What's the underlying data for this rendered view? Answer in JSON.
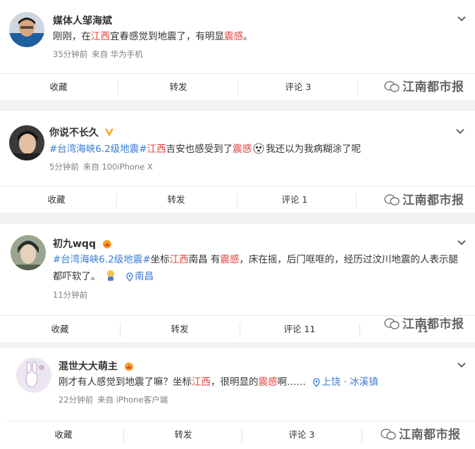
{
  "posts": [
    {
      "username": "媒体人邹海斌",
      "text_parts": [
        "刚刚，在",
        "江西",
        "宜春感觉到地震了，有明显",
        "震感",
        "。"
      ],
      "time": "35分钟前",
      "source": "来自 华为手机",
      "actions": [
        "收藏",
        "转发",
        "评论 3"
      ]
    },
    {
      "username": "你说不长久",
      "text_parts": [
        "#台湾海峡6.2级地震#",
        "江西",
        "吉安也感受到了",
        "震感",
        "我还以为我病糊涂了呢"
      ],
      "time": "5分钟前",
      "source": "来自 iPhone X",
      "source_prefix": "100",
      "actions": [
        "收藏",
        "转发",
        "评论 1"
      ]
    },
    {
      "username": "初九wqq",
      "text_parts": [
        "#台湾海峡6.2级地震#",
        "坐标",
        "江西",
        "南昌 有",
        "震感",
        "，床在摇，后门哐哐的，经历过汶川地震的人表示腿"
      ],
      "text_line2": "都吓软了。",
      "location": "南昌",
      "time": "11分钟前",
      "actions": [
        "收藏",
        "转发",
        "评论 11",
        "11"
      ]
    },
    {
      "username": "混世大大萌主",
      "text_parts": [
        "刚才有人感觉到地震了嘛？坐标",
        "江西",
        "，很明显的",
        "震感",
        "啊……"
      ],
      "location": "上饶 · 冰溪镇",
      "time": "22分钟前",
      "source": "来自 iPhone客户端",
      "actions": [
        "收藏",
        "转发",
        "评论 3"
      ]
    }
  ],
  "watermark": "江南都市报",
  "colors": {
    "link": "#3a7bd5",
    "highlight": "#e0433e",
    "badge": "#f5a623"
  }
}
